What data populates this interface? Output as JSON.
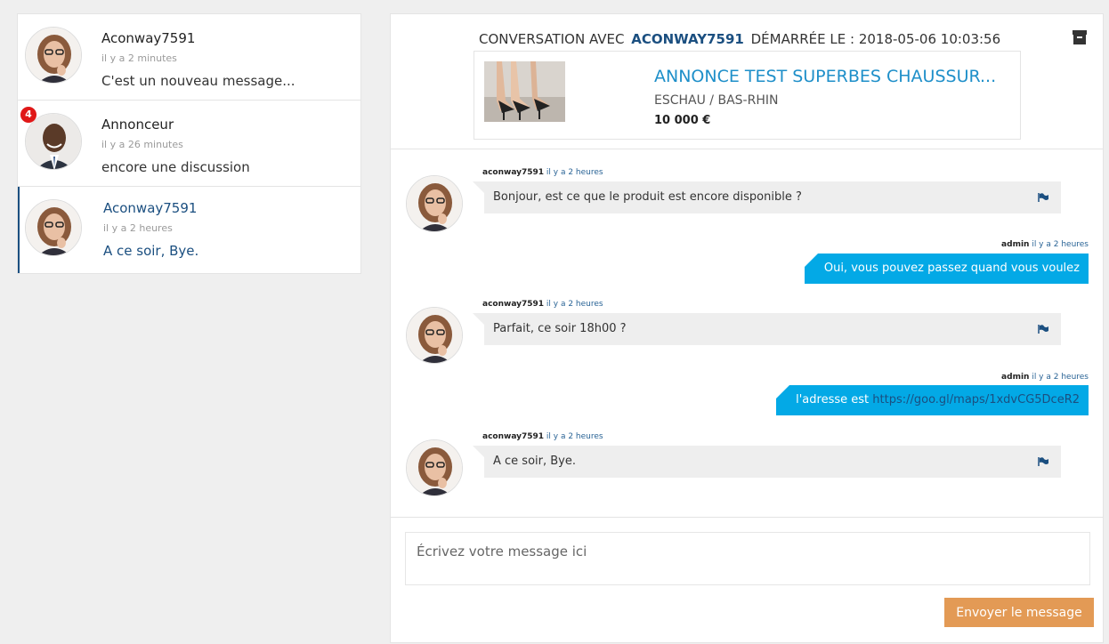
{
  "conversations": [
    {
      "name": "Aconway7591",
      "time": "il y a 2 minutes",
      "preview": "C'est un nouveau message...",
      "active": false
    },
    {
      "name": "Annonceur",
      "time": "il y a 26 minutes",
      "preview": "encore une discussion",
      "badge": "4",
      "active": false
    },
    {
      "name": "Aconway7591",
      "time": "il y a 2 heures",
      "preview": "A ce soir, Bye.",
      "active": true
    }
  ],
  "header": {
    "prefix": "CONVERSATION AVEC",
    "user": "ACONWAY7591",
    "started": "DÉMARRÉE LE : 2018-05-06 10:03:56",
    "archive_icon": "archive-icon"
  },
  "listing": {
    "title": "ANNONCE TEST SUPERBES CHAUSSUR...",
    "location": "ESCHAU / BAS-RHIN",
    "price": "10 000 €"
  },
  "messages": [
    {
      "direction": "in",
      "user": "aconway7591",
      "time": "il y a 2 heures",
      "text": "Bonjour, est ce que le produit est encore disponible ?"
    },
    {
      "direction": "out",
      "user": "admin",
      "time": "il y a 2 heures",
      "text": "Oui, vous pouvez passez quand vous voulez"
    },
    {
      "direction": "in",
      "user": "aconway7591",
      "time": "il y a 2 heures",
      "text": "Parfait, ce soir 18h00 ?"
    },
    {
      "direction": "out",
      "user": "admin",
      "time": "il y a 2 heures",
      "text": "l'adresse est",
      "link": "https://goo.gl/maps/1xdvCG5DceR2"
    },
    {
      "direction": "in",
      "user": "aconway7591",
      "time": "il y a 2 heures",
      "text": "A ce soir, Bye."
    }
  ],
  "composer": {
    "placeholder": "Écrivez votre message ici",
    "send_label": "Envoyer le message"
  },
  "colors": {
    "accent_dark": "#1b4f80",
    "accent_blue": "#1e8fc9",
    "bubble_out": "#03a9e6",
    "send_button": "#e39a55",
    "badge": "#e01818"
  }
}
